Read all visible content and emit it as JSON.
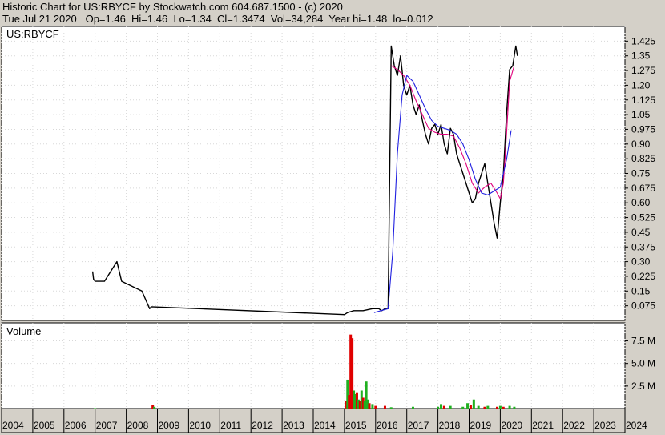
{
  "header": {
    "line1": "Historic Chart for US:RBYCF by Stockwatch.com 604.687.1500 - (c) 2020",
    "line2": "Tue Jul 21 2020   Op=1.46  Hi=1.46  Lo=1.34  Cl=1.3474  Vol=34,284  Year hi=1.48  lo=0.012"
  },
  "chart_data": [
    {
      "type": "line",
      "title": "US:RBYCF",
      "panel": "price",
      "ylim": [
        0,
        1.5
      ],
      "y_ticks": [
        "0.075",
        "0.15",
        "0.225",
        "0.30",
        "0.375",
        "0.45",
        "0.525",
        "0.60",
        "0.675",
        "0.75",
        "0.825",
        "0.90",
        "0.975",
        "1.05",
        "1.125",
        "1.20",
        "1.275",
        "1.35",
        "1.425"
      ],
      "y_tick_values": [
        0.075,
        0.15,
        0.225,
        0.3,
        0.375,
        0.45,
        0.525,
        0.6,
        0.675,
        0.75,
        0.825,
        0.9,
        0.975,
        1.05,
        1.125,
        1.2,
        1.275,
        1.35,
        1.425
      ],
      "x_ticks": [
        "2004",
        "2005",
        "2006",
        "2007",
        "2008",
        "2009",
        "2010",
        "2011",
        "2012",
        "2013",
        "2014",
        "2015",
        "2016",
        "2017",
        "2018",
        "2019",
        "2020",
        "2021",
        "2022",
        "2023",
        "2024"
      ],
      "grid": true,
      "series": [
        {
          "role": "close",
          "color": "#000000",
          "x": [
            2006.92,
            2006.95,
            2007.0,
            2007.1,
            2007.3,
            2007.7,
            2007.85,
            2008.5,
            2008.75,
            2008.8,
            2015.0,
            2015.1,
            2015.3,
            2015.6,
            2015.9,
            2016.0,
            2016.1,
            2016.2,
            2016.3,
            2016.4,
            2016.5,
            2016.55,
            2016.6,
            2016.7,
            2016.8,
            2016.9,
            2017.0,
            2017.1,
            2017.2,
            2017.3,
            2017.4,
            2017.5,
            2017.6,
            2017.7,
            2017.8,
            2017.9,
            2018.0,
            2018.1,
            2018.2,
            2018.3,
            2018.4,
            2018.5,
            2018.6,
            2018.7,
            2018.8,
            2018.9,
            2019.0,
            2019.1,
            2019.2,
            2019.3,
            2019.4,
            2019.5,
            2019.6,
            2019.7,
            2019.8,
            2019.9,
            2020.0,
            2020.1,
            2020.2,
            2020.3,
            2020.4,
            2020.5,
            2020.55
          ],
          "y": [
            0.25,
            0.21,
            0.2,
            0.2,
            0.2,
            0.3,
            0.2,
            0.15,
            0.06,
            0.07,
            0.03,
            0.04,
            0.05,
            0.05,
            0.06,
            0.06,
            0.06,
            0.05,
            0.06,
            0.06,
            1.4,
            1.35,
            1.3,
            1.25,
            1.35,
            1.2,
            1.15,
            1.2,
            1.1,
            1.05,
            1.1,
            1.02,
            0.95,
            0.9,
            0.98,
            1.0,
            0.95,
            1.0,
            0.9,
            0.85,
            0.98,
            0.95,
            0.85,
            0.8,
            0.75,
            0.7,
            0.65,
            0.6,
            0.62,
            0.7,
            0.75,
            0.8,
            0.7,
            0.6,
            0.5,
            0.42,
            0.6,
            0.75,
            1.05,
            1.28,
            1.3,
            1.4,
            1.35
          ]
        },
        {
          "role": "moving-average-short",
          "color": "#e0007c",
          "x": [
            2016.5,
            2016.7,
            2016.9,
            2017.1,
            2017.3,
            2017.5,
            2017.7,
            2017.9,
            2018.1,
            2018.3,
            2018.5,
            2018.7,
            2018.9,
            2019.1,
            2019.3,
            2019.5,
            2019.7,
            2019.9,
            2020.0,
            2020.1,
            2020.2,
            2020.3,
            2020.45
          ],
          "y": [
            1.3,
            1.28,
            1.25,
            1.2,
            1.12,
            1.05,
            0.98,
            0.96,
            0.95,
            0.95,
            0.94,
            0.88,
            0.8,
            0.7,
            0.65,
            0.68,
            0.7,
            0.65,
            0.62,
            0.7,
            0.95,
            1.22,
            1.3
          ]
        },
        {
          "role": "moving-average-long",
          "color": "#2020e0",
          "x": [
            2015.95,
            2016.4,
            2016.55,
            2016.7,
            2016.85,
            2017.0,
            2017.2,
            2017.4,
            2017.6,
            2017.8,
            2018.0,
            2018.2,
            2018.4,
            2018.6,
            2018.8,
            2019.0,
            2019.2,
            2019.4,
            2019.6,
            2019.8,
            2020.0,
            2020.2,
            2020.35
          ],
          "y": [
            0.04,
            0.06,
            0.35,
            0.85,
            1.15,
            1.25,
            1.22,
            1.15,
            1.08,
            1.02,
            0.99,
            0.98,
            0.97,
            0.95,
            0.9,
            0.82,
            0.72,
            0.65,
            0.64,
            0.66,
            0.68,
            0.82,
            0.97
          ]
        }
      ]
    },
    {
      "type": "bar",
      "title": "Volume",
      "panel": "volume",
      "ylim": [
        0,
        9.5
      ],
      "y_ticks": [
        "2.5 M",
        "5.0 M",
        "7.5 M"
      ],
      "y_tick_values": [
        2.5,
        5.0,
        7.5
      ],
      "x_ticks": [
        "2004",
        "2005",
        "2006",
        "2007",
        "2008",
        "2009",
        "2010",
        "2011",
        "2012",
        "2013",
        "2014",
        "2015",
        "2016",
        "2017",
        "2018",
        "2019",
        "2020",
        "2021",
        "2022",
        "2023",
        "2024"
      ],
      "grid": true,
      "up_color": "#20b020",
      "down_color": "#e00000",
      "bars": [
        {
          "x": 2007.0,
          "v": 0.05,
          "dir": "up"
        },
        {
          "x": 2008.85,
          "v": 0.4,
          "dir": "down"
        },
        {
          "x": 2008.9,
          "v": 0.2,
          "dir": "up"
        },
        {
          "x": 2015.05,
          "v": 0.8,
          "dir": "down"
        },
        {
          "x": 2015.1,
          "v": 3.2,
          "dir": "up"
        },
        {
          "x": 2015.15,
          "v": 1.5,
          "dir": "down"
        },
        {
          "x": 2015.2,
          "v": 8.2,
          "dir": "down"
        },
        {
          "x": 2015.25,
          "v": 7.8,
          "dir": "down"
        },
        {
          "x": 2015.3,
          "v": 2.0,
          "dir": "up"
        },
        {
          "x": 2015.35,
          "v": 1.6,
          "dir": "up"
        },
        {
          "x": 2015.4,
          "v": 1.8,
          "dir": "down"
        },
        {
          "x": 2015.45,
          "v": 1.0,
          "dir": "up"
        },
        {
          "x": 2015.5,
          "v": 0.8,
          "dir": "down"
        },
        {
          "x": 2015.55,
          "v": 2.0,
          "dir": "up"
        },
        {
          "x": 2015.6,
          "v": 1.2,
          "dir": "down"
        },
        {
          "x": 2015.65,
          "v": 0.9,
          "dir": "up"
        },
        {
          "x": 2015.7,
          "v": 3.0,
          "dir": "up"
        },
        {
          "x": 2015.75,
          "v": 1.0,
          "dir": "up"
        },
        {
          "x": 2015.8,
          "v": 0.6,
          "dir": "down"
        },
        {
          "x": 2015.9,
          "v": 0.5,
          "dir": "up"
        },
        {
          "x": 2016.0,
          "v": 0.3,
          "dir": "down"
        },
        {
          "x": 2016.3,
          "v": 0.3,
          "dir": "down"
        },
        {
          "x": 2016.5,
          "v": 0.15,
          "dir": "up"
        },
        {
          "x": 2017.2,
          "v": 0.2,
          "dir": "up"
        },
        {
          "x": 2018.0,
          "v": 0.2,
          "dir": "up"
        },
        {
          "x": 2018.1,
          "v": 0.5,
          "dir": "up"
        },
        {
          "x": 2018.2,
          "v": 0.3,
          "dir": "down"
        },
        {
          "x": 2018.4,
          "v": 0.3,
          "dir": "up"
        },
        {
          "x": 2018.8,
          "v": 0.2,
          "dir": "up"
        },
        {
          "x": 2018.95,
          "v": 0.6,
          "dir": "up"
        },
        {
          "x": 2019.05,
          "v": 0.4,
          "dir": "down"
        },
        {
          "x": 2019.15,
          "v": 1.0,
          "dir": "up"
        },
        {
          "x": 2019.3,
          "v": 0.3,
          "dir": "up"
        },
        {
          "x": 2019.5,
          "v": 0.2,
          "dir": "down"
        },
        {
          "x": 2019.6,
          "v": 0.3,
          "dir": "up"
        },
        {
          "x": 2019.9,
          "v": 0.2,
          "dir": "down"
        },
        {
          "x": 2020.0,
          "v": 0.3,
          "dir": "up"
        },
        {
          "x": 2020.1,
          "v": 0.2,
          "dir": "down"
        },
        {
          "x": 2020.3,
          "v": 0.3,
          "dir": "up"
        },
        {
          "x": 2020.45,
          "v": 0.2,
          "dir": "up"
        }
      ]
    }
  ]
}
